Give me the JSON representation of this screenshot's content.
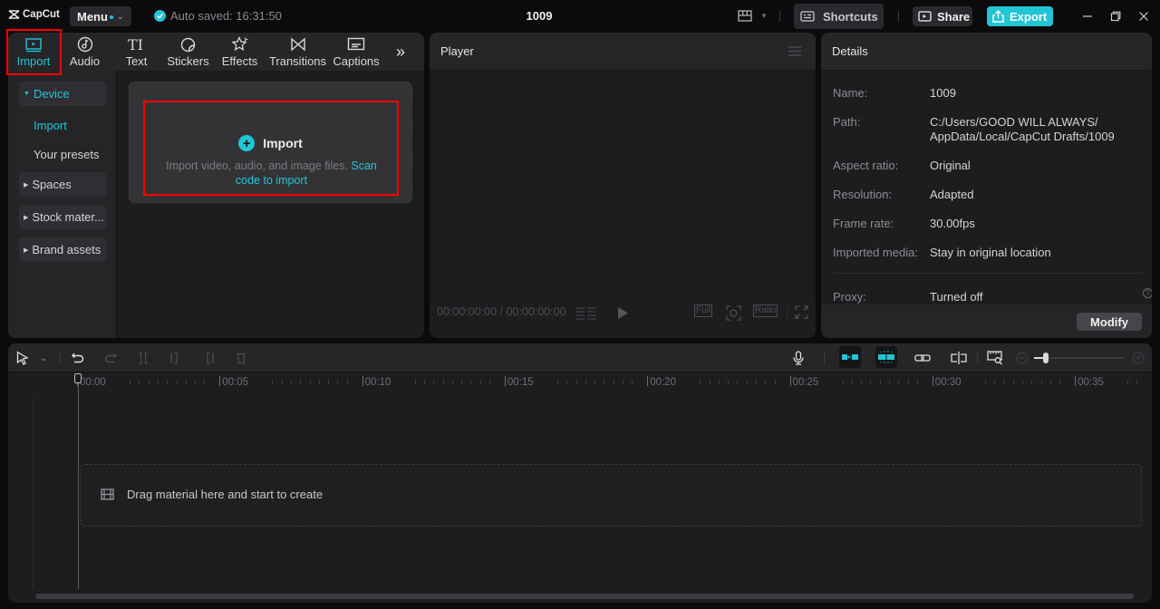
{
  "app": {
    "name": "CapCut",
    "project_title": "1009",
    "autosave_text": "Auto saved: 16:31:50",
    "accent_color": "#22c5d6"
  },
  "titlebar": {
    "menu_label": "Menu",
    "shortcuts_label": "Shortcuts",
    "share_label": "Share",
    "export_label": "Export"
  },
  "media_tabs": [
    {
      "label": "Import",
      "icon": "import-icon",
      "active": true
    },
    {
      "label": "Audio",
      "icon": "audio-icon"
    },
    {
      "label": "Text",
      "icon": "text-icon"
    },
    {
      "label": "Stickers",
      "icon": "stickers-icon"
    },
    {
      "label": "Effects",
      "icon": "effects-icon"
    },
    {
      "label": "Transitions",
      "icon": "transitions-icon"
    },
    {
      "label": "Captions",
      "icon": "captions-icon"
    }
  ],
  "more_tabs_glyph": "»",
  "subnav": {
    "categories": [
      {
        "label": "Device",
        "expanded": true
      },
      {
        "label": "Spaces"
      },
      {
        "label": "Stock mater..."
      },
      {
        "label": "Brand assets"
      }
    ],
    "device_items": [
      {
        "label": "Import",
        "active": true
      },
      {
        "label": "Your presets"
      }
    ]
  },
  "import_zone": {
    "title": "Import",
    "description": "Import video, audio, and image files.",
    "link_text": "Scan code to import"
  },
  "player": {
    "title": "Player",
    "timecode_current": "00:00:00:00",
    "timecode_total": "00:00:00:00",
    "full_label": "Full",
    "ratio_label": "Ratio"
  },
  "details": {
    "title": "Details",
    "rows": [
      {
        "label": "Name:",
        "value": "1009"
      },
      {
        "label": "Path:",
        "value": "C:/Users/GOOD WILL ALWAYS/ AppData/Local/CapCut Drafts/1009"
      },
      {
        "label": "Aspect ratio:",
        "value": "Original"
      },
      {
        "label": "Resolution:",
        "value": "Adapted"
      },
      {
        "label": "Frame rate:",
        "value": "30.00fps"
      },
      {
        "label": "Imported media:",
        "value": "Stay in original location"
      },
      {
        "label": "Proxy:",
        "value": "Turned off"
      }
    ],
    "modify_label": "Modify"
  },
  "timeline": {
    "ruler_labels": [
      "00:00",
      "00:05",
      "00:10",
      "00:15",
      "00:20",
      "00:25",
      "00:30",
      "00:35"
    ],
    "drag_hint": "Drag material here and start to create",
    "zoom_level": 0.1
  }
}
